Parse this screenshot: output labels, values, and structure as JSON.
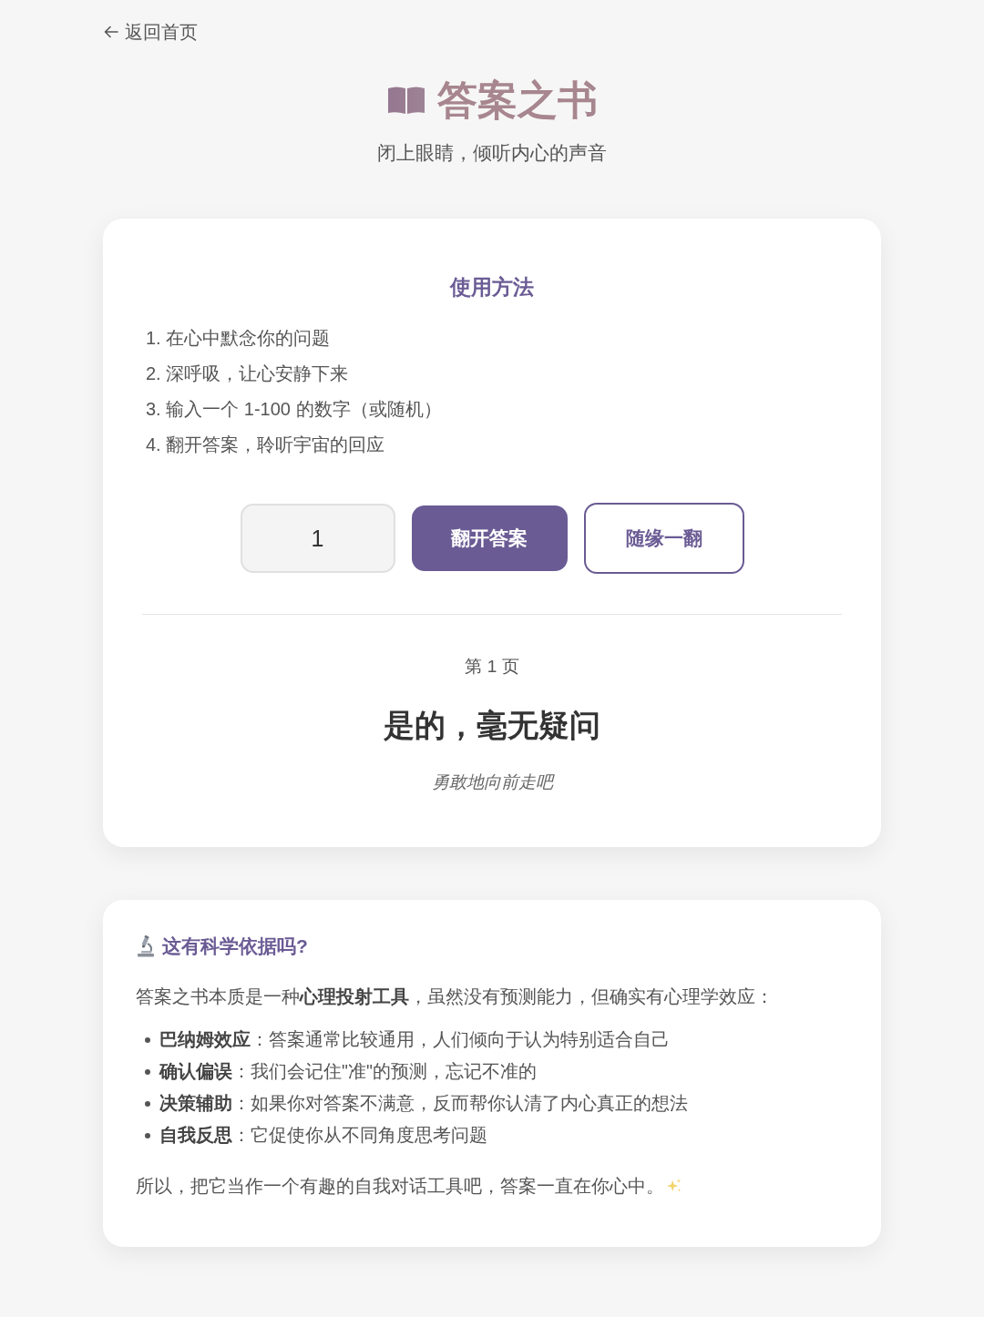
{
  "back_link": {
    "label": "返回首页"
  },
  "header": {
    "title": "答案之书",
    "subtitle": "闭上眼睛，倾听内心的声音"
  },
  "instructions": {
    "title": "使用方法",
    "steps": [
      "1. 在心中默念你的问题",
      "2. 深呼吸，让心安静下来",
      "3. 输入一个 1-100 的数字（或随机）",
      "4. 翻开答案，聆听宇宙的回应"
    ]
  },
  "controls": {
    "number_input": {
      "value": "1"
    },
    "buttons": [
      {
        "label": "翻开答案",
        "kind": "primary"
      },
      {
        "label": "随缘一翻",
        "kind": "outline"
      }
    ]
  },
  "result": {
    "page": "第 1 页",
    "answer": "是的，毫无疑问",
    "hint": "勇敢地向前走吧"
  },
  "science": {
    "title": "这有科学依据吗?",
    "intro": "答案之书本质是一种**心理投射工具**，虽然没有预测能力，但确实有心理学效应：",
    "points": [
      "**巴纳姆效应**：答案通常比较通用，人们倾向于认为特别适合自己",
      "**确认偏误**：我们会记住\"准\"的预测，忘记不准的",
      "**决策辅助**：如果你对答案不满意，反而帮你认清了内心真正的想法",
      "**自我反思**：它促使你从不同角度思考问题"
    ],
    "conclusion": "所以，把它当作一个有趣的自我对话工具吧，答案一直在你心中。"
  }
}
